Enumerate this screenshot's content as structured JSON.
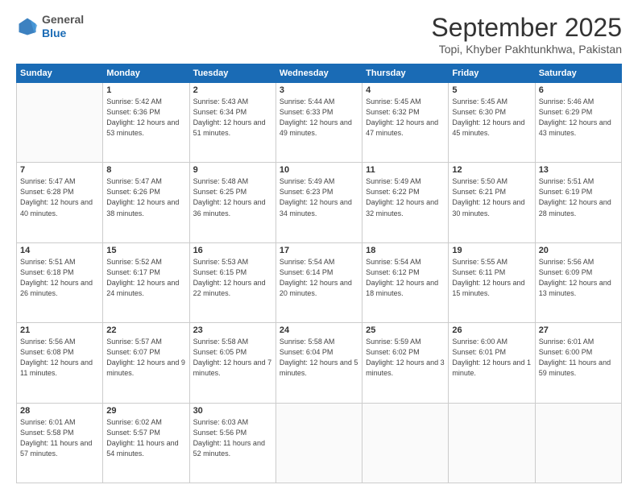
{
  "logo": {
    "general": "General",
    "blue": "Blue"
  },
  "header": {
    "title": "September 2025",
    "subtitle": "Topi, Khyber Pakhtunkhwa, Pakistan"
  },
  "days_of_week": [
    "Sunday",
    "Monday",
    "Tuesday",
    "Wednesday",
    "Thursday",
    "Friday",
    "Saturday"
  ],
  "weeks": [
    [
      {
        "num": "",
        "sunrise": "",
        "sunset": "",
        "daylight": ""
      },
      {
        "num": "1",
        "sunrise": "Sunrise: 5:42 AM",
        "sunset": "Sunset: 6:36 PM",
        "daylight": "Daylight: 12 hours and 53 minutes."
      },
      {
        "num": "2",
        "sunrise": "Sunrise: 5:43 AM",
        "sunset": "Sunset: 6:34 PM",
        "daylight": "Daylight: 12 hours and 51 minutes."
      },
      {
        "num": "3",
        "sunrise": "Sunrise: 5:44 AM",
        "sunset": "Sunset: 6:33 PM",
        "daylight": "Daylight: 12 hours and 49 minutes."
      },
      {
        "num": "4",
        "sunrise": "Sunrise: 5:45 AM",
        "sunset": "Sunset: 6:32 PM",
        "daylight": "Daylight: 12 hours and 47 minutes."
      },
      {
        "num": "5",
        "sunrise": "Sunrise: 5:45 AM",
        "sunset": "Sunset: 6:30 PM",
        "daylight": "Daylight: 12 hours and 45 minutes."
      },
      {
        "num": "6",
        "sunrise": "Sunrise: 5:46 AM",
        "sunset": "Sunset: 6:29 PM",
        "daylight": "Daylight: 12 hours and 43 minutes."
      }
    ],
    [
      {
        "num": "7",
        "sunrise": "Sunrise: 5:47 AM",
        "sunset": "Sunset: 6:28 PM",
        "daylight": "Daylight: 12 hours and 40 minutes."
      },
      {
        "num": "8",
        "sunrise": "Sunrise: 5:47 AM",
        "sunset": "Sunset: 6:26 PM",
        "daylight": "Daylight: 12 hours and 38 minutes."
      },
      {
        "num": "9",
        "sunrise": "Sunrise: 5:48 AM",
        "sunset": "Sunset: 6:25 PM",
        "daylight": "Daylight: 12 hours and 36 minutes."
      },
      {
        "num": "10",
        "sunrise": "Sunrise: 5:49 AM",
        "sunset": "Sunset: 6:23 PM",
        "daylight": "Daylight: 12 hours and 34 minutes."
      },
      {
        "num": "11",
        "sunrise": "Sunrise: 5:49 AM",
        "sunset": "Sunset: 6:22 PM",
        "daylight": "Daylight: 12 hours and 32 minutes."
      },
      {
        "num": "12",
        "sunrise": "Sunrise: 5:50 AM",
        "sunset": "Sunset: 6:21 PM",
        "daylight": "Daylight: 12 hours and 30 minutes."
      },
      {
        "num": "13",
        "sunrise": "Sunrise: 5:51 AM",
        "sunset": "Sunset: 6:19 PM",
        "daylight": "Daylight: 12 hours and 28 minutes."
      }
    ],
    [
      {
        "num": "14",
        "sunrise": "Sunrise: 5:51 AM",
        "sunset": "Sunset: 6:18 PM",
        "daylight": "Daylight: 12 hours and 26 minutes."
      },
      {
        "num": "15",
        "sunrise": "Sunrise: 5:52 AM",
        "sunset": "Sunset: 6:17 PM",
        "daylight": "Daylight: 12 hours and 24 minutes."
      },
      {
        "num": "16",
        "sunrise": "Sunrise: 5:53 AM",
        "sunset": "Sunset: 6:15 PM",
        "daylight": "Daylight: 12 hours and 22 minutes."
      },
      {
        "num": "17",
        "sunrise": "Sunrise: 5:54 AM",
        "sunset": "Sunset: 6:14 PM",
        "daylight": "Daylight: 12 hours and 20 minutes."
      },
      {
        "num": "18",
        "sunrise": "Sunrise: 5:54 AM",
        "sunset": "Sunset: 6:12 PM",
        "daylight": "Daylight: 12 hours and 18 minutes."
      },
      {
        "num": "19",
        "sunrise": "Sunrise: 5:55 AM",
        "sunset": "Sunset: 6:11 PM",
        "daylight": "Daylight: 12 hours and 15 minutes."
      },
      {
        "num": "20",
        "sunrise": "Sunrise: 5:56 AM",
        "sunset": "Sunset: 6:09 PM",
        "daylight": "Daylight: 12 hours and 13 minutes."
      }
    ],
    [
      {
        "num": "21",
        "sunrise": "Sunrise: 5:56 AM",
        "sunset": "Sunset: 6:08 PM",
        "daylight": "Daylight: 12 hours and 11 minutes."
      },
      {
        "num": "22",
        "sunrise": "Sunrise: 5:57 AM",
        "sunset": "Sunset: 6:07 PM",
        "daylight": "Daylight: 12 hours and 9 minutes."
      },
      {
        "num": "23",
        "sunrise": "Sunrise: 5:58 AM",
        "sunset": "Sunset: 6:05 PM",
        "daylight": "Daylight: 12 hours and 7 minutes."
      },
      {
        "num": "24",
        "sunrise": "Sunrise: 5:58 AM",
        "sunset": "Sunset: 6:04 PM",
        "daylight": "Daylight: 12 hours and 5 minutes."
      },
      {
        "num": "25",
        "sunrise": "Sunrise: 5:59 AM",
        "sunset": "Sunset: 6:02 PM",
        "daylight": "Daylight: 12 hours and 3 minutes."
      },
      {
        "num": "26",
        "sunrise": "Sunrise: 6:00 AM",
        "sunset": "Sunset: 6:01 PM",
        "daylight": "Daylight: 12 hours and 1 minute."
      },
      {
        "num": "27",
        "sunrise": "Sunrise: 6:01 AM",
        "sunset": "Sunset: 6:00 PM",
        "daylight": "Daylight: 11 hours and 59 minutes."
      }
    ],
    [
      {
        "num": "28",
        "sunrise": "Sunrise: 6:01 AM",
        "sunset": "Sunset: 5:58 PM",
        "daylight": "Daylight: 11 hours and 57 minutes."
      },
      {
        "num": "29",
        "sunrise": "Sunrise: 6:02 AM",
        "sunset": "Sunset: 5:57 PM",
        "daylight": "Daylight: 11 hours and 54 minutes."
      },
      {
        "num": "30",
        "sunrise": "Sunrise: 6:03 AM",
        "sunset": "Sunset: 5:56 PM",
        "daylight": "Daylight: 11 hours and 52 minutes."
      },
      {
        "num": "",
        "sunrise": "",
        "sunset": "",
        "daylight": ""
      },
      {
        "num": "",
        "sunrise": "",
        "sunset": "",
        "daylight": ""
      },
      {
        "num": "",
        "sunrise": "",
        "sunset": "",
        "daylight": ""
      },
      {
        "num": "",
        "sunrise": "",
        "sunset": "",
        "daylight": ""
      }
    ]
  ]
}
